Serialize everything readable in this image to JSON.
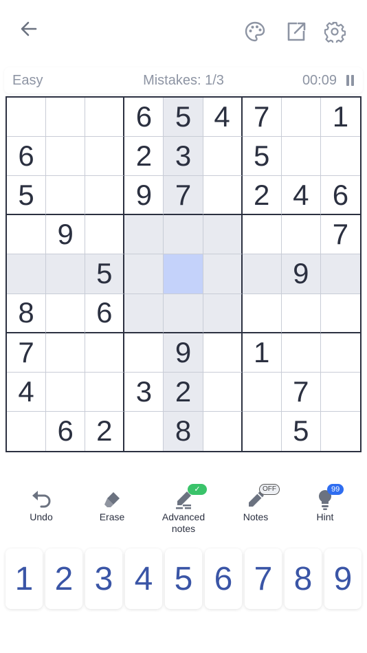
{
  "header": {
    "back_icon": "arrow-left-icon",
    "theme_icon": "palette-icon",
    "share_icon": "share-icon",
    "settings_icon": "gear-icon"
  },
  "status": {
    "difficulty": "Easy",
    "mistakes": "Mistakes: 1/3",
    "timer": "00:09"
  },
  "board": {
    "rows": [
      [
        "",
        "",
        "",
        "6",
        "5",
        "4",
        "7",
        "",
        "1"
      ],
      [
        "6",
        "",
        "",
        "2",
        "3",
        "",
        "5",
        "",
        ""
      ],
      [
        "5",
        "",
        "",
        "9",
        "7",
        "",
        "2",
        "4",
        "6"
      ],
      [
        "",
        "9",
        "",
        "",
        "",
        "",
        "",
        "",
        "7"
      ],
      [
        "",
        "",
        "5",
        "",
        "",
        "",
        "",
        "9",
        ""
      ],
      [
        "8",
        "",
        "6",
        "",
        "",
        "",
        "",
        "",
        ""
      ],
      [
        "7",
        "",
        "",
        "",
        "9",
        "",
        "1",
        "",
        ""
      ],
      [
        "4",
        "",
        "",
        "3",
        "2",
        "",
        "",
        "7",
        ""
      ],
      [
        "",
        "6",
        "2",
        "",
        "8",
        "",
        "",
        "5",
        ""
      ]
    ],
    "selected": {
      "row": 5,
      "col": 5
    }
  },
  "tools": [
    {
      "label": "Undo",
      "icon": "undo-icon"
    },
    {
      "label": "Erase",
      "icon": "eraser-icon"
    },
    {
      "label": "Advanced notes",
      "icon": "pencil-lines-icon",
      "badge": "✓"
    },
    {
      "label": "Notes",
      "icon": "pencil-icon",
      "badge": "OFF"
    },
    {
      "label": "Hint",
      "icon": "lightbulb-icon",
      "badge": "99"
    }
  ],
  "numpad": [
    "1",
    "2",
    "3",
    "4",
    "5",
    "6",
    "7",
    "8",
    "9"
  ],
  "colors": {
    "accent": "#3a55a6",
    "selected_cell": "#c4d2fa",
    "highlight_cell": "#e8eaf0",
    "badge_green": "#3ac36a",
    "badge_blue": "#2f6df0"
  }
}
